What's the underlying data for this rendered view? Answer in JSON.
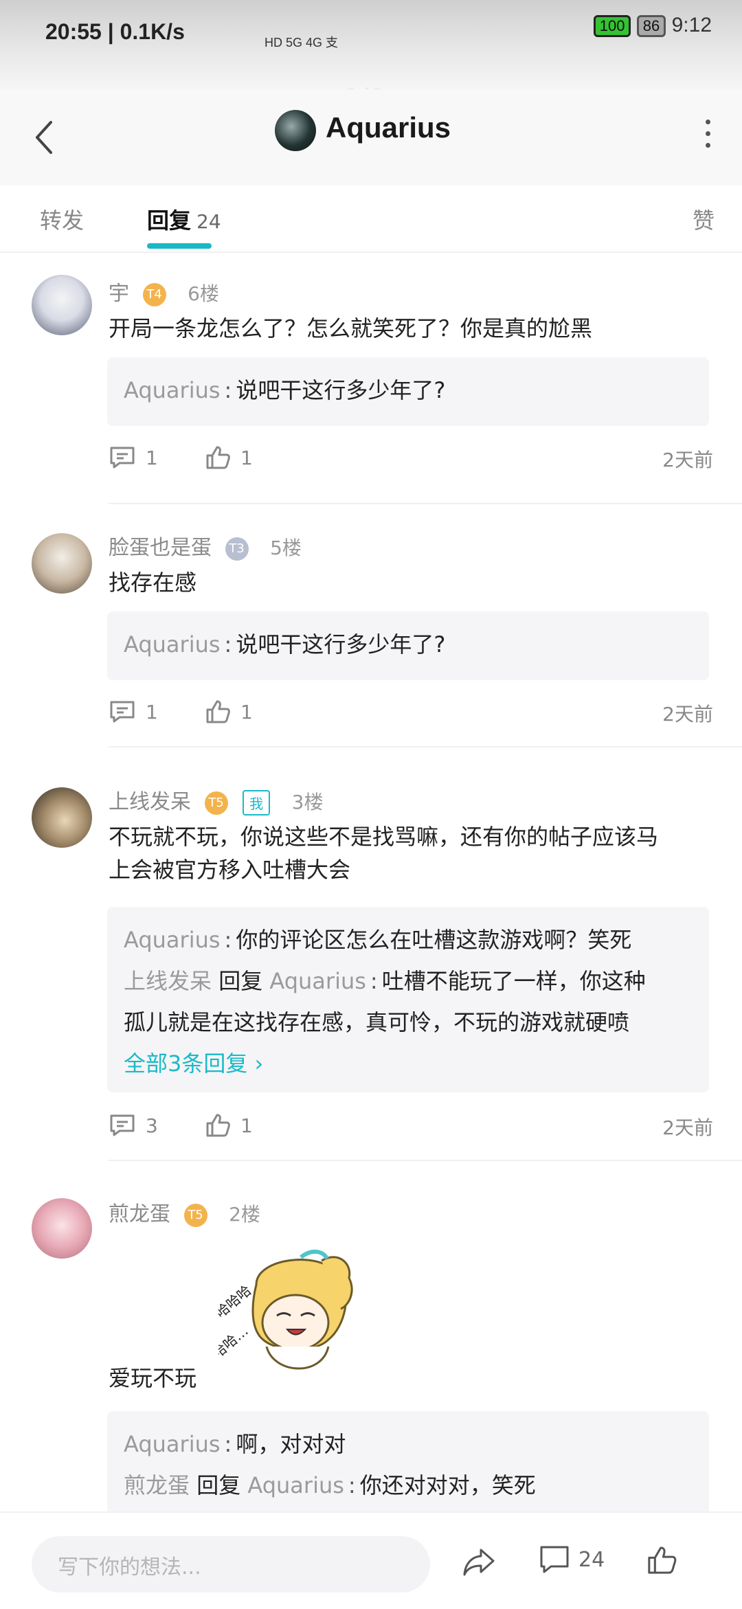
{
  "status": {
    "time_speed": "20:55 | 0.1K/s",
    "mid": "HD 5G 4G 支",
    "battery": "100",
    "battery2": "86",
    "clock2": "9:12"
  },
  "header": {
    "ghost_title": "3/3",
    "title": "Aquarius"
  },
  "tabs": {
    "forward": "转发",
    "reply": "回复",
    "reply_count": "24",
    "like": "赞"
  },
  "comments": [
    {
      "user": "宇",
      "level": "T4",
      "floor": "6楼",
      "text": "开局一条龙怎么了？怎么就笑死了？你是真的尬黑",
      "replies": [
        {
          "name": "Aquarius",
          "text": "说吧干这行多少年了?"
        }
      ],
      "reply_count": "1",
      "like_count": "1",
      "time": "2天前"
    },
    {
      "user": "脸蛋也是蛋",
      "level": "T3",
      "floor": "5楼",
      "text": "找存在感",
      "replies": [
        {
          "name": "Aquarius",
          "text": "说吧干这行多少年了?"
        }
      ],
      "reply_count": "1",
      "like_count": "1",
      "time": "2天前"
    },
    {
      "user": "上线发呆",
      "level": "T5",
      "me_badge": "我",
      "floor": "3楼",
      "text_line1": "不玩就不玩，你说这些不是找骂嘛，还有你的帖子应该马",
      "text_line2": "上会被官方移入吐槽大会",
      "replies": [
        {
          "name": "Aquarius",
          "text": "你的评论区怎么在吐槽这款游戏啊？笑死"
        },
        {
          "name": "上线发呆",
          "reply_word": "回复",
          "target": "Aquarius",
          "text": "吐槽不能玩了一样，你这种",
          "text2": "孤儿就是在这找存在感，真可怜，不玩的游戏就硬喷"
        }
      ],
      "all_replies": "全部3条回复 ›",
      "reply_count": "3",
      "like_count": "1",
      "time": "2天前"
    },
    {
      "user": "煎龙蛋",
      "level": "T5",
      "floor": "2楼",
      "text": "爱玩不玩",
      "replies": [
        {
          "name": "Aquarius",
          "text": "啊，对对对"
        },
        {
          "name": "煎龙蛋",
          "reply_word": "回复",
          "target": "Aquarius",
          "text": "你还对对对，笑死"
        }
      ]
    }
  ],
  "bottom": {
    "placeholder": "写下你的想法...",
    "comment_count": "24"
  },
  "colors": {
    "accent": "#1ab9c8",
    "level_gold": "#f3b34c",
    "level_silver": "#b8bfd0"
  }
}
